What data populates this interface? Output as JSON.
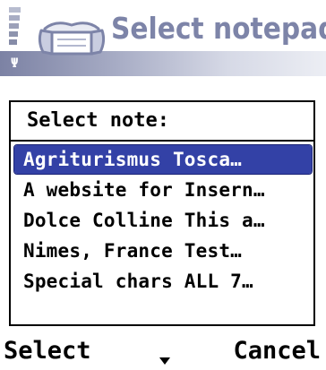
{
  "statusbar": {
    "signal_icon": "signal-strength-icon",
    "antenna_glyph": "Ψ"
  },
  "title": {
    "icon": "notepad-icon",
    "text": "Select notepad"
  },
  "popup": {
    "heading": "Select note:",
    "items": [
      {
        "label": "Agriturismus Tosca…",
        "selected": true
      },
      {
        "label": "A website for Insern…",
        "selected": false
      },
      {
        "label": "Dolce Colline This a…",
        "selected": false
      },
      {
        "label": "Nimes, France Test…",
        "selected": false
      },
      {
        "label": "Special chars ALL 7…",
        "selected": false
      }
    ]
  },
  "softkeys": {
    "left": "Select",
    "right": "Cancel",
    "middle_icon": "scroll-down-icon"
  },
  "colors": {
    "title_text": "#7d84a8",
    "selection": "#3341a6",
    "background": "#ffffff"
  }
}
